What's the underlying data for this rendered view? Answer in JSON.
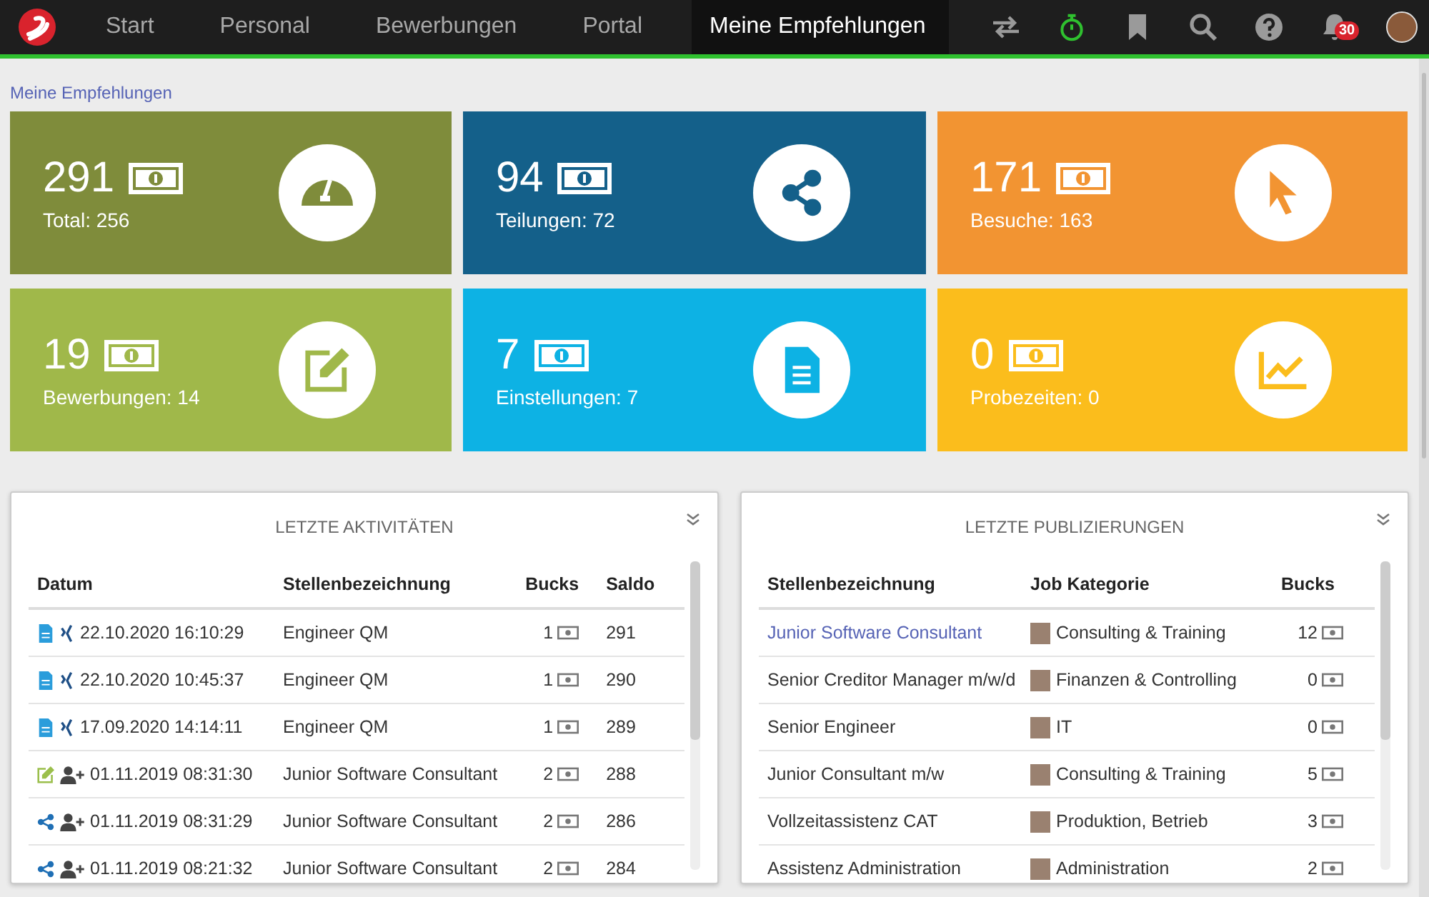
{
  "nav": {
    "tabs": [
      {
        "label": "Start",
        "selected": false
      },
      {
        "label": "Personal",
        "selected": false
      },
      {
        "label": "Bewerbungen",
        "selected": false
      },
      {
        "label": "Portal",
        "selected": false
      },
      {
        "label": "Meine Empfehlungen",
        "selected": true
      }
    ],
    "notification_count": "30"
  },
  "breadcrumb": "Meine Empfehlungen",
  "tiles": [
    {
      "value": "291",
      "label": "Total: 256",
      "color": "#7f8c3b",
      "kind": "gauge"
    },
    {
      "value": "94",
      "label": "Teilungen: 72",
      "color": "#14608a",
      "kind": "share"
    },
    {
      "value": "171",
      "label": "Besuche: 163",
      "color": "#f29432",
      "kind": "pointer"
    },
    {
      "value": "19",
      "label": "Bewerbungen: 14",
      "color": "#a0b84a",
      "kind": "edit"
    },
    {
      "value": "7",
      "label": "Einstellungen: 7",
      "color": "#0db2e4",
      "kind": "document"
    },
    {
      "value": "0",
      "label": "Probezeiten: 0",
      "color": "#fbbd1c",
      "kind": "chart"
    }
  ],
  "activities": {
    "title": "LETZTE AKTIVITÄTEN",
    "columns": [
      "Datum",
      "Stellenbezeichnung",
      "Bucks",
      "Saldo"
    ],
    "rows": [
      {
        "kind": "document-xing",
        "date": "22.10.2020 16:10:29",
        "job": "Engineer QM",
        "bucks": "1",
        "saldo": "291"
      },
      {
        "kind": "document-xing",
        "date": "22.10.2020 10:45:37",
        "job": "Engineer QM",
        "bucks": "1",
        "saldo": "290"
      },
      {
        "kind": "document-xing",
        "date": "17.09.2020 14:14:11",
        "job": "Engineer QM",
        "bucks": "1",
        "saldo": "289"
      },
      {
        "kind": "edit-user-add",
        "date": "01.11.2019 08:31:30",
        "job": "Junior Software Consultant",
        "bucks": "2",
        "saldo": "288"
      },
      {
        "kind": "share-user-add",
        "date": "01.11.2019 08:31:29",
        "job": "Junior Software Consultant",
        "bucks": "2",
        "saldo": "286"
      },
      {
        "kind": "share-user-add",
        "date": "01.11.2019 08:21:32",
        "job": "Junior Software Consultant",
        "bucks": "2",
        "saldo": "284"
      }
    ]
  },
  "publications": {
    "title": "LETZTE PUBLIZIERUNGEN",
    "columns": [
      "Stellenbezeichnung",
      "Job Kategorie",
      "Bucks"
    ],
    "rows": [
      {
        "job": "Junior Software Consultant",
        "linked": true,
        "category": "Consulting & Training",
        "bucks": "12"
      },
      {
        "job": "Senior Creditor Manager m/w/d",
        "linked": false,
        "category": "Finanzen & Controlling",
        "bucks": "0"
      },
      {
        "job": "Senior Engineer",
        "linked": false,
        "category": "IT",
        "bucks": "0"
      },
      {
        "job": "Junior Consultant m/w",
        "linked": false,
        "category": "Consulting & Training",
        "bucks": "5"
      },
      {
        "job": "Vollzeitassistenz CAT",
        "linked": false,
        "category": "Produktion, Betrieb",
        "bucks": "3"
      },
      {
        "job": "Assistenz Administration",
        "linked": false,
        "category": "Administration",
        "bucks": "2"
      }
    ]
  }
}
